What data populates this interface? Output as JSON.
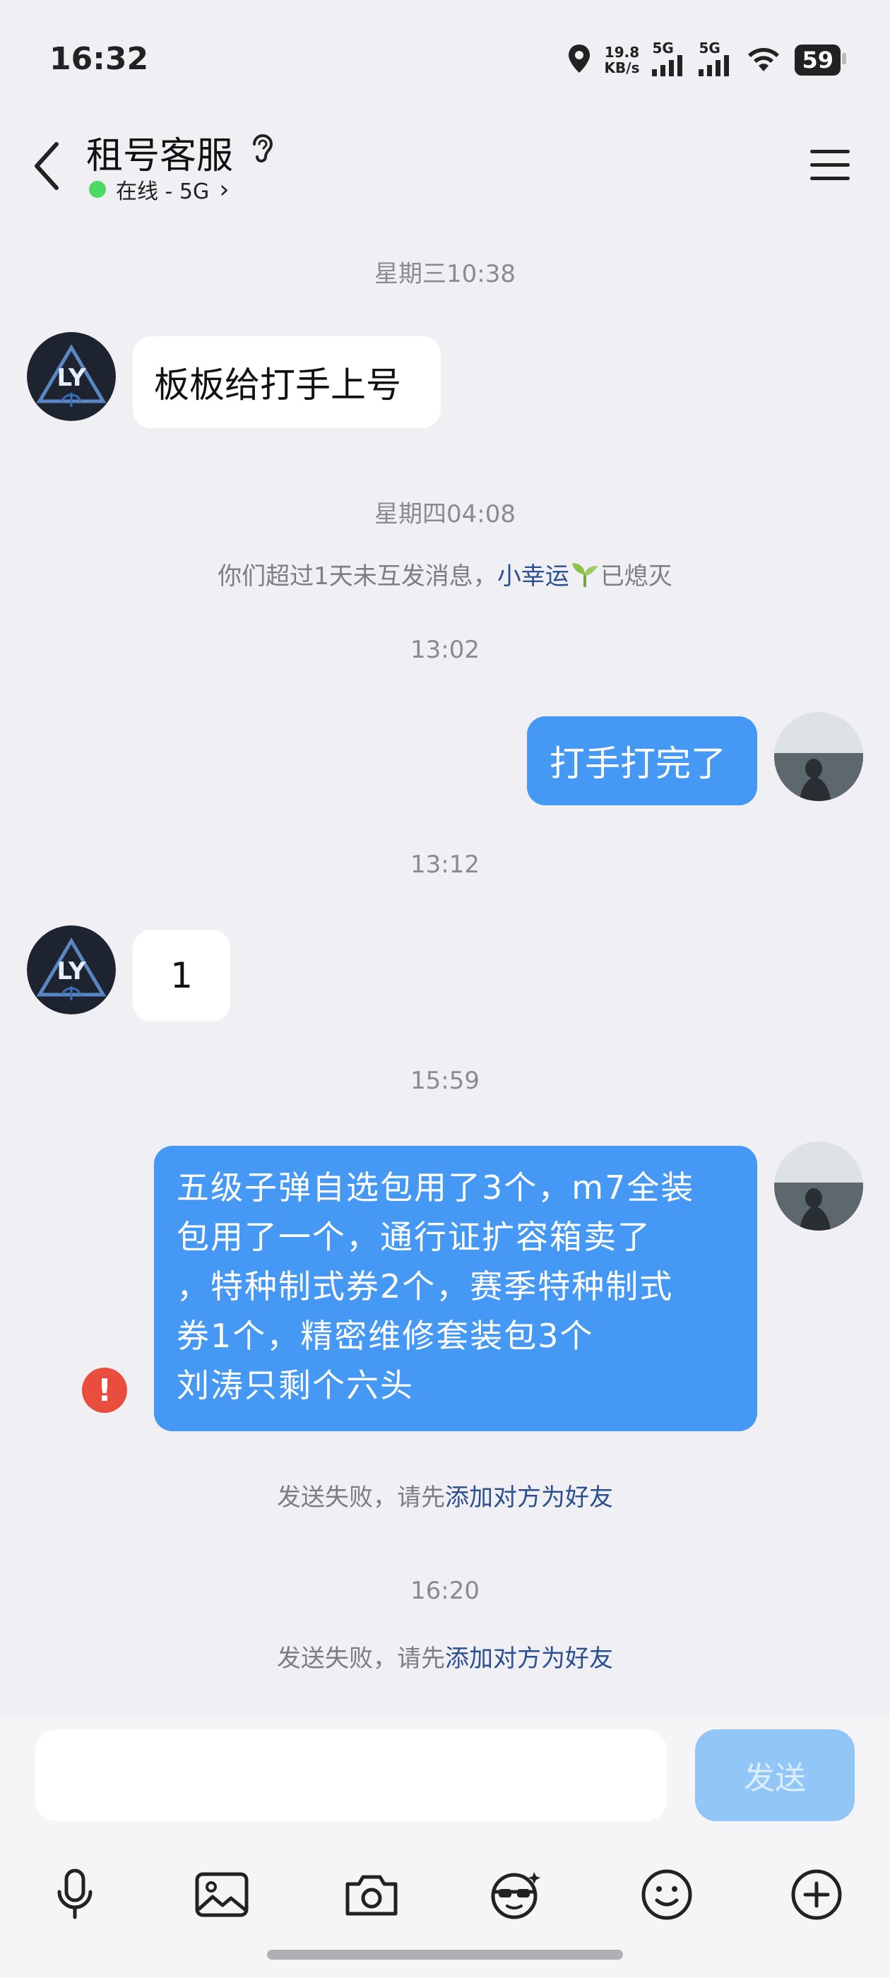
{
  "status_bar": {
    "time": "16:32",
    "net_speed_value": "19.8",
    "net_speed_unit": "KB/s",
    "signal1_label": "5G",
    "signal2_label": "5G",
    "battery": "59",
    "icons": [
      "location-icon",
      "signal-icon",
      "signal-icon",
      "wifi-icon",
      "battery-icon"
    ]
  },
  "header": {
    "title": "租号客服",
    "status": "在线 - 5G",
    "status_chevron": "›",
    "icons": [
      "back-arrow-icon",
      "ear-icon",
      "menu-icon"
    ]
  },
  "chat": {
    "timestamps": [
      "星期三10:38",
      "星期四04:08",
      "13:02",
      "13:12",
      "15:59",
      "16:20"
    ],
    "system_note": {
      "prefix": "你们超过1天未互发消息，",
      "link": "小幸运",
      "suffix": "已熄灭"
    },
    "messages": [
      {
        "side": "incoming",
        "text": "板板给打手上号"
      },
      {
        "side": "outgoing",
        "text": "打手打完了"
      },
      {
        "side": "incoming",
        "text": "1"
      },
      {
        "side": "outgoing",
        "lines": [
          "五级子弹自选包用了3个，m7全装",
          "包用了一个，通行证扩容箱卖了",
          "，特种制式券2个，赛季特种制式",
          "券1个，精密维修套装包3个",
          "刘涛只剩个六头"
        ],
        "error_mark": "!"
      }
    ],
    "send_failed": {
      "prefix": "发送失败，请先",
      "link": "添加对方为好友"
    }
  },
  "input_bar": {
    "placeholder": "",
    "send_label": "发送",
    "tools": [
      "microphone-icon",
      "image-icon",
      "camera-icon",
      "sticker-icon",
      "emoji-icon",
      "plus-icon"
    ]
  },
  "colors": {
    "background": "#efeff4",
    "outgoing_bubble": "#4598f3",
    "incoming_bubble": "#ffffff",
    "link": "#2b4f8f",
    "online": "#4cd964",
    "error": "#e84d3d",
    "send_disabled": "#92c6f7"
  }
}
